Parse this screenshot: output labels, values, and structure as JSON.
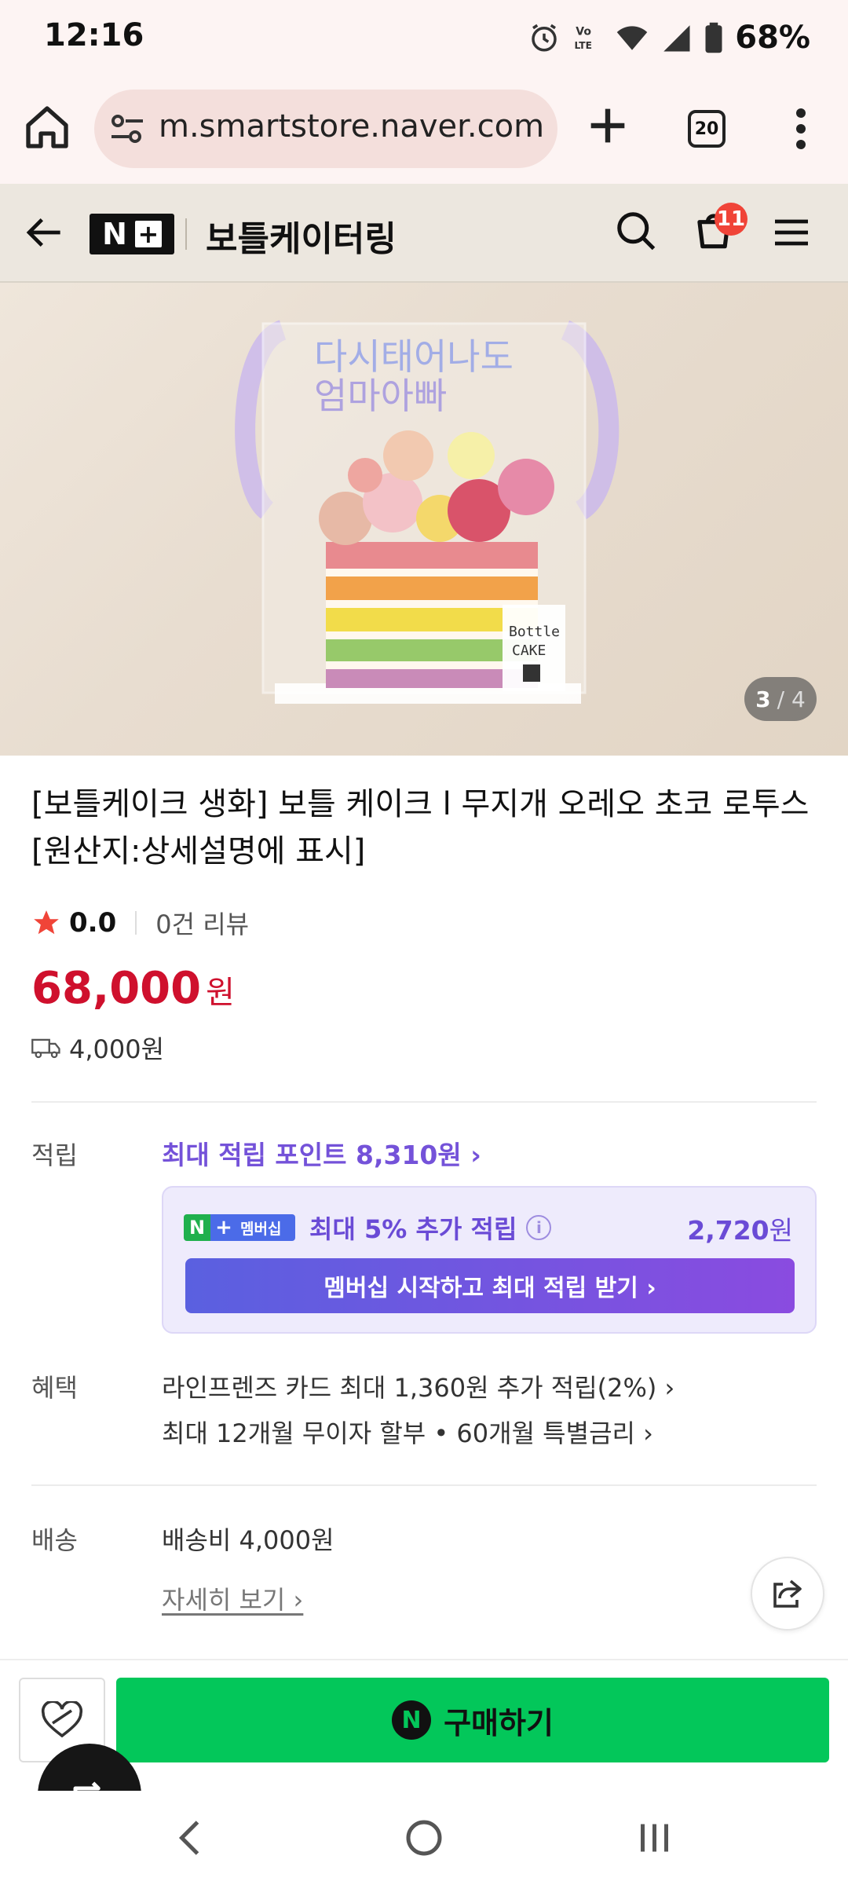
{
  "status_bar": {
    "time": "12:16",
    "battery": "68%",
    "icons": [
      "alarm-icon",
      "volte-icon",
      "wifi-icon",
      "signal-icon",
      "battery-icon"
    ]
  },
  "browser": {
    "url": "m.smartstore.naver.com",
    "tab_count": "20"
  },
  "store_header": {
    "brand_logo": "N+",
    "store_name": "보틀케이터링",
    "cart_count": "11"
  },
  "hero": {
    "image_index": "3",
    "image_total": "/ 4"
  },
  "product": {
    "title": "[보틀케이크 생화] 보틀 케이크 l 무지개 오레오 초코 로투스 [원산지:상세설명에 표시]",
    "rating": "0.0",
    "review_count": "0건 리뷰",
    "price": "68,000",
    "price_unit": "원",
    "shipping_fee": "4,000원"
  },
  "points": {
    "label": "적립",
    "max_points_link": "최대 적립 포인트 8,310원 ›",
    "membership": {
      "badge_text": "멤버십",
      "description": "최대 5% 추가 적립",
      "amount": "2,720",
      "amount_unit": "원",
      "cta": "멤버십 시작하고 최대 적립 받기 ›"
    }
  },
  "benefits": {
    "label": "혜택",
    "lines": [
      "라인프렌즈 카드 최대 1,360원 추가 적립(2%) ›",
      "최대 12개월 무이자 할부 • 60개월 특별금리 ›"
    ]
  },
  "delivery": {
    "label": "배송",
    "fee_text": "배송비 4,000원",
    "detail_link": "자세히 보기 ›"
  },
  "buy_bar": {
    "buy_label": "구매하기"
  },
  "colors": {
    "price_red": "#cf102d",
    "naver_green": "#03c75a",
    "membership_purple": "#6a4bd6",
    "cart_badge": "#f04438"
  }
}
